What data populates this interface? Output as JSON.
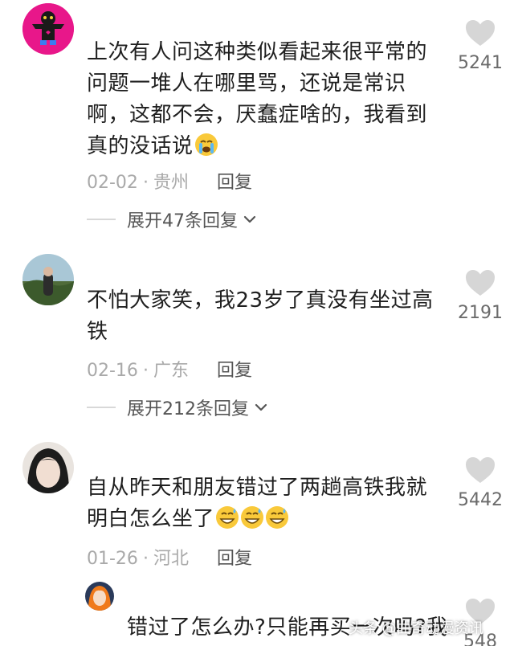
{
  "comments": [
    {
      "text": "上次有人问这种类似看起来很平常的问题一堆人在哪里骂，还说是常识啊，这都不会，厌蠢症啥的，我看到真的没话说",
      "emoji": "loudly-crying-face",
      "date": "02-02",
      "location": "贵州",
      "reply_label": "回复",
      "expand_label": "展开47条回复",
      "likes": "5241"
    },
    {
      "text": "不怕大家笑，我23岁了真没有坐过高铁",
      "date": "02-16",
      "location": "广东",
      "reply_label": "回复",
      "expand_label": "展开212条回复",
      "likes": "2191"
    },
    {
      "text": "自从昨天和朋友错过了两趟高铁我就明白怎么坐了",
      "emoji": "grinning-face-with-sweat",
      "date": "01-26",
      "location": "河北",
      "reply_label": "回复",
      "likes": "5442"
    },
    {
      "text": "错过了怎么办?只能再买一次吗?我",
      "likes": "548"
    }
  ],
  "separator": "·",
  "watermark": "头条 @曲奇动漫资讯",
  "colors": {
    "meta_gray": "#a9a9a9",
    "heart_gray": "#d6d6d6",
    "text": "#1f1f1f"
  }
}
